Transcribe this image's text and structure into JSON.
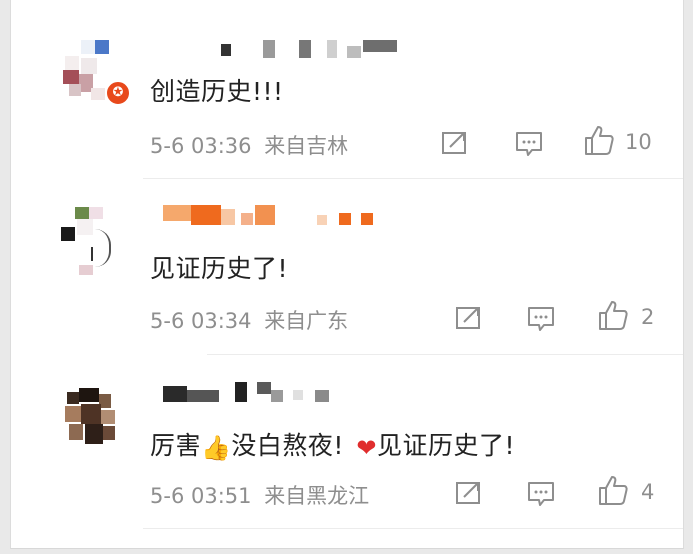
{
  "comments": [
    {
      "text": "创造历史!!!",
      "time": "5-6 03:36",
      "location": "来自吉林",
      "likes": "10",
      "verified": true
    },
    {
      "text": "见证历史了!",
      "time": "5-6 03:34",
      "location": "来自广东",
      "likes": "2",
      "verified": false
    },
    {
      "text_part1": "厉害",
      "emoji1": "👍",
      "text_part2": "没白熬夜!",
      "emoji2": "❤",
      "text_part3": "见证历史了!",
      "time": "5-6 03:51",
      "location": "来自黑龙江",
      "likes": "4",
      "verified": false
    }
  ],
  "icons": {
    "repost": "repost-icon",
    "comment": "comment-icon",
    "like": "like-icon",
    "badge": "verified-badge-icon"
  },
  "colors": {
    "text": "#222222",
    "meta": "#8e8e8e",
    "badge": "#e8491b",
    "username_orange": "#f07a2a"
  }
}
